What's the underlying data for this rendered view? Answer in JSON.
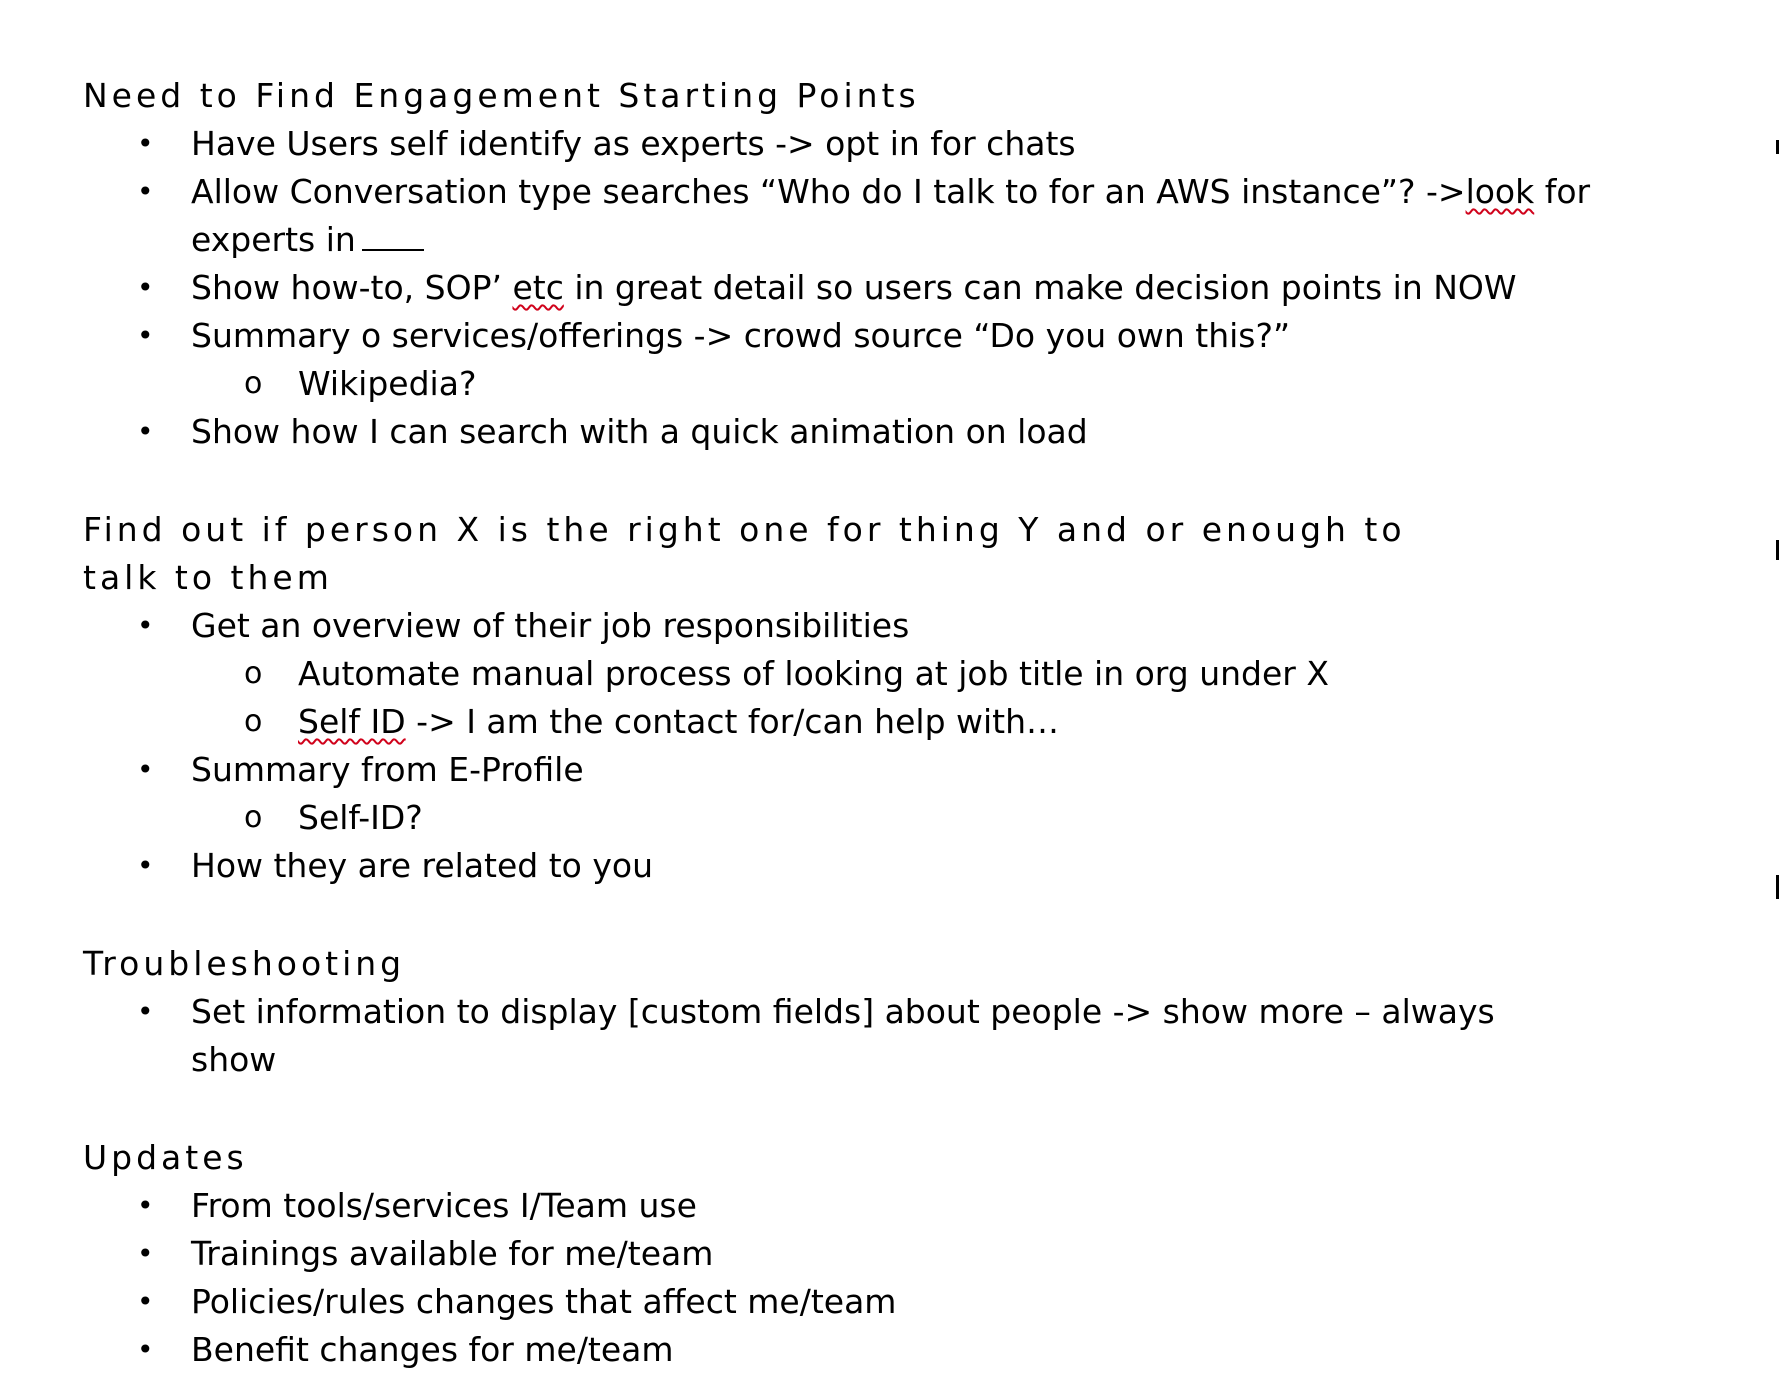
{
  "sections": [
    {
      "heading": "Need to Find Engagement Starting Points",
      "items": [
        {
          "text": "Have Users self identify as experts -> opt in for chats"
        },
        {
          "text_before": "Allow Conversation type searches “Who do I talk to for an AWS instance”? ->",
          "spell_word": "look",
          "text_after": " for experts in"
        },
        {
          "text_before": "Show how-to, SOP’ ",
          "spell_word": "etc",
          "text_after": " in great detail so users can make decision points in NOW"
        },
        {
          "text": "Summary o services/offerings -> crowd source “Do you own this?”",
          "sub": [
            "Wikipedia?"
          ]
        },
        {
          "text": "Show how I can search with a quick animation on load"
        }
      ]
    },
    {
      "heading": "Find out if person X is the right one for thing Y and or enough to talk to them",
      "items": [
        {
          "text": "Get an overview of their job responsibilities",
          "sub": [
            "Automate manual process of looking at job title in org under X"
          ],
          "sub_spell": {
            "word": "Self ID",
            "after": " -> I am the contact for/can help with…"
          }
        },
        {
          "text": "Summary from E-Profile",
          "sub": [
            "Self-ID?"
          ]
        },
        {
          "text": "How they are related to you"
        }
      ]
    },
    {
      "heading": "Troubleshooting",
      "items": [
        {
          "text": "Set information to display [custom fields] about people -> show more – always show"
        }
      ]
    },
    {
      "heading": "Updates",
      "items": [
        {
          "text": "From tools/services I/Team use"
        },
        {
          "text": "Trainings available for me/team"
        },
        {
          "text": "Policies/rules changes that affect me/team"
        },
        {
          "text": "Benefit changes for me/team"
        }
      ]
    }
  ],
  "bullet_l1": "•",
  "bullet_l2": "o"
}
